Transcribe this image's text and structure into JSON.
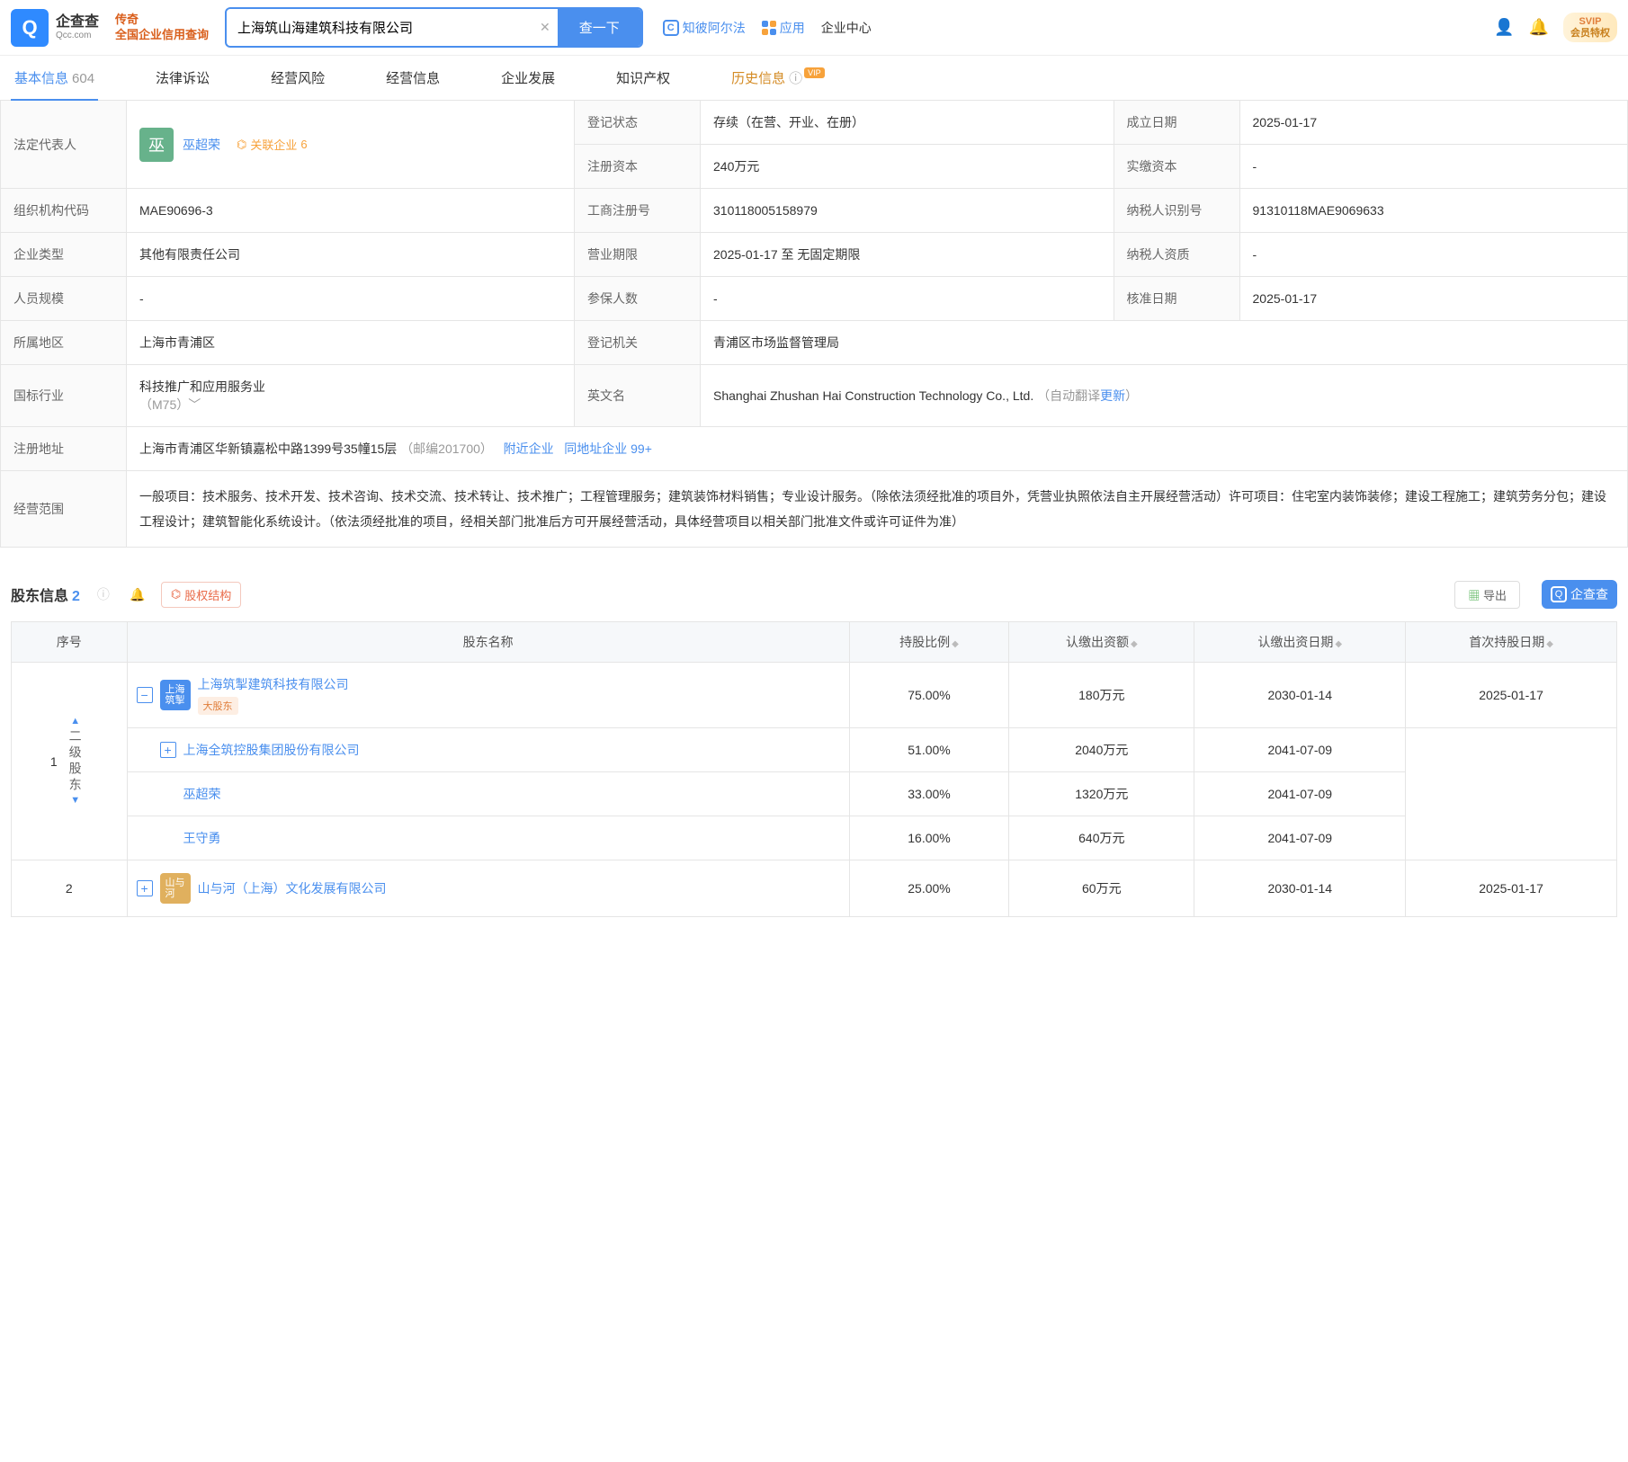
{
  "header": {
    "logo_cn": "企查查",
    "logo_en": "Qcc.com",
    "slogan_l1": "传奇",
    "slogan_l2": "全国企业信用查询",
    "search_value": "上海筑山海建筑科技有限公司",
    "search_btn": "查一下",
    "link_zhibi": "知彼阿尔法",
    "link_apps": "应用",
    "link_center": "企业中心",
    "vip_l1": "SVIP",
    "vip_l2": "会员特权"
  },
  "tabs": [
    {
      "label": "基本信息",
      "count": "604",
      "active": true
    },
    {
      "label": "法律诉讼"
    },
    {
      "label": "经营风险"
    },
    {
      "label": "经营信息"
    },
    {
      "label": "企业发展"
    },
    {
      "label": "知识产权"
    },
    {
      "label": "历史信息",
      "vip": true
    }
  ],
  "info": {
    "legal_rep_label": "法定代表人",
    "legal_rep_avatar": "巫",
    "legal_rep_name": "巫超荣",
    "related_label": "关联企业",
    "related_count": "6",
    "reg_status_label": "登记状态",
    "reg_status": "存续（在营、开业、在册）",
    "est_date_label": "成立日期",
    "est_date": "2025-01-17",
    "reg_capital_label": "注册资本",
    "reg_capital": "240万元",
    "paid_capital_label": "实缴资本",
    "paid_capital": "-",
    "org_code_label": "组织机构代码",
    "org_code": "MAE90696-3",
    "biz_reg_label": "工商注册号",
    "biz_reg": "310118005158979",
    "tax_id_label": "纳税人识别号",
    "tax_id": "91310118MAE9069633",
    "enterprise_type_label": "企业类型",
    "enterprise_type": "其他有限责任公司",
    "biz_term_label": "营业期限",
    "biz_term": "2025-01-17 至 无固定期限",
    "tax_qual_label": "纳税人资质",
    "tax_qual": "-",
    "staff_size_label": "人员规模",
    "staff_size": "-",
    "insured_label": "参保人数",
    "insured": "-",
    "approval_date_label": "核准日期",
    "approval_date": "2025-01-17",
    "region_label": "所属地区",
    "region": "上海市青浦区",
    "reg_auth_label": "登记机关",
    "reg_auth": "青浦区市场监督管理局",
    "industry_label": "国标行业",
    "industry": "科技推广和应用服务业",
    "industry_code": "（M75）",
    "en_name_label": "英文名",
    "en_name": "Shanghai Zhushan Hai Construction Technology Co., Ltd.",
    "auto_trans": "（自动翻译",
    "update_link": "更新",
    "auto_trans_end": "）",
    "reg_addr_label": "注册地址",
    "reg_addr": "上海市青浦区华新镇嘉松中路1399号35幢15层",
    "postcode": "（邮编201700）",
    "nearby": "附近企业",
    "same_addr": "同地址企业 99+",
    "scope_label": "经营范围",
    "scope": "一般项目：技术服务、技术开发、技术咨询、技术交流、技术转让、技术推广；工程管理服务；建筑装饰材料销售；专业设计服务。（除依法须经批准的项目外，凭营业执照依法自主开展经营活动）许可项目：住宅室内装饰装修；建设工程施工；建筑劳务分包；建设工程设计；建筑智能化系统设计。（依法须经批准的项目，经相关部门批准后方可开展经营活动，具体经营项目以相关部门批准文件或许可证件为准）"
  },
  "shareholders": {
    "title": "股东信息",
    "count": "2",
    "struct_btn": "股权结构",
    "export_btn": "导出",
    "brand": "企查查",
    "cols": {
      "no": "序号",
      "name": "股东名称",
      "ratio": "持股比例",
      "amount": "认缴出资额",
      "sub_date": "认缴出资日期",
      "first_date": "首次持股日期"
    },
    "l2_label": "二级股东",
    "rows": [
      {
        "no": "1",
        "avatar": "上海\n筑掣",
        "avatar_color": "#4a8fee",
        "name": "上海筑掣建筑科技有限公司",
        "tag": "大股东",
        "ratio": "75.00%",
        "amount": "180万元",
        "sub_date": "2030-01-14",
        "first_date": "2025-01-17"
      },
      {
        "no": "2",
        "avatar": "山与\n河",
        "avatar_color": "#e0b05e",
        "name": "山与河（上海）文化发展有限公司",
        "ratio": "25.00%",
        "amount": "60万元",
        "sub_date": "2030-01-14",
        "first_date": "2025-01-17"
      }
    ],
    "sub_rows": [
      {
        "name": "上海全筑控股集团股份有限公司",
        "ratio": "51.00%",
        "amount": "2040万元",
        "sub_date": "2041-07-09"
      },
      {
        "name": "巫超荣",
        "ratio": "33.00%",
        "amount": "1320万元",
        "sub_date": "2041-07-09"
      },
      {
        "name": "王守勇",
        "ratio": "16.00%",
        "amount": "640万元",
        "sub_date": "2041-07-09"
      }
    ]
  }
}
